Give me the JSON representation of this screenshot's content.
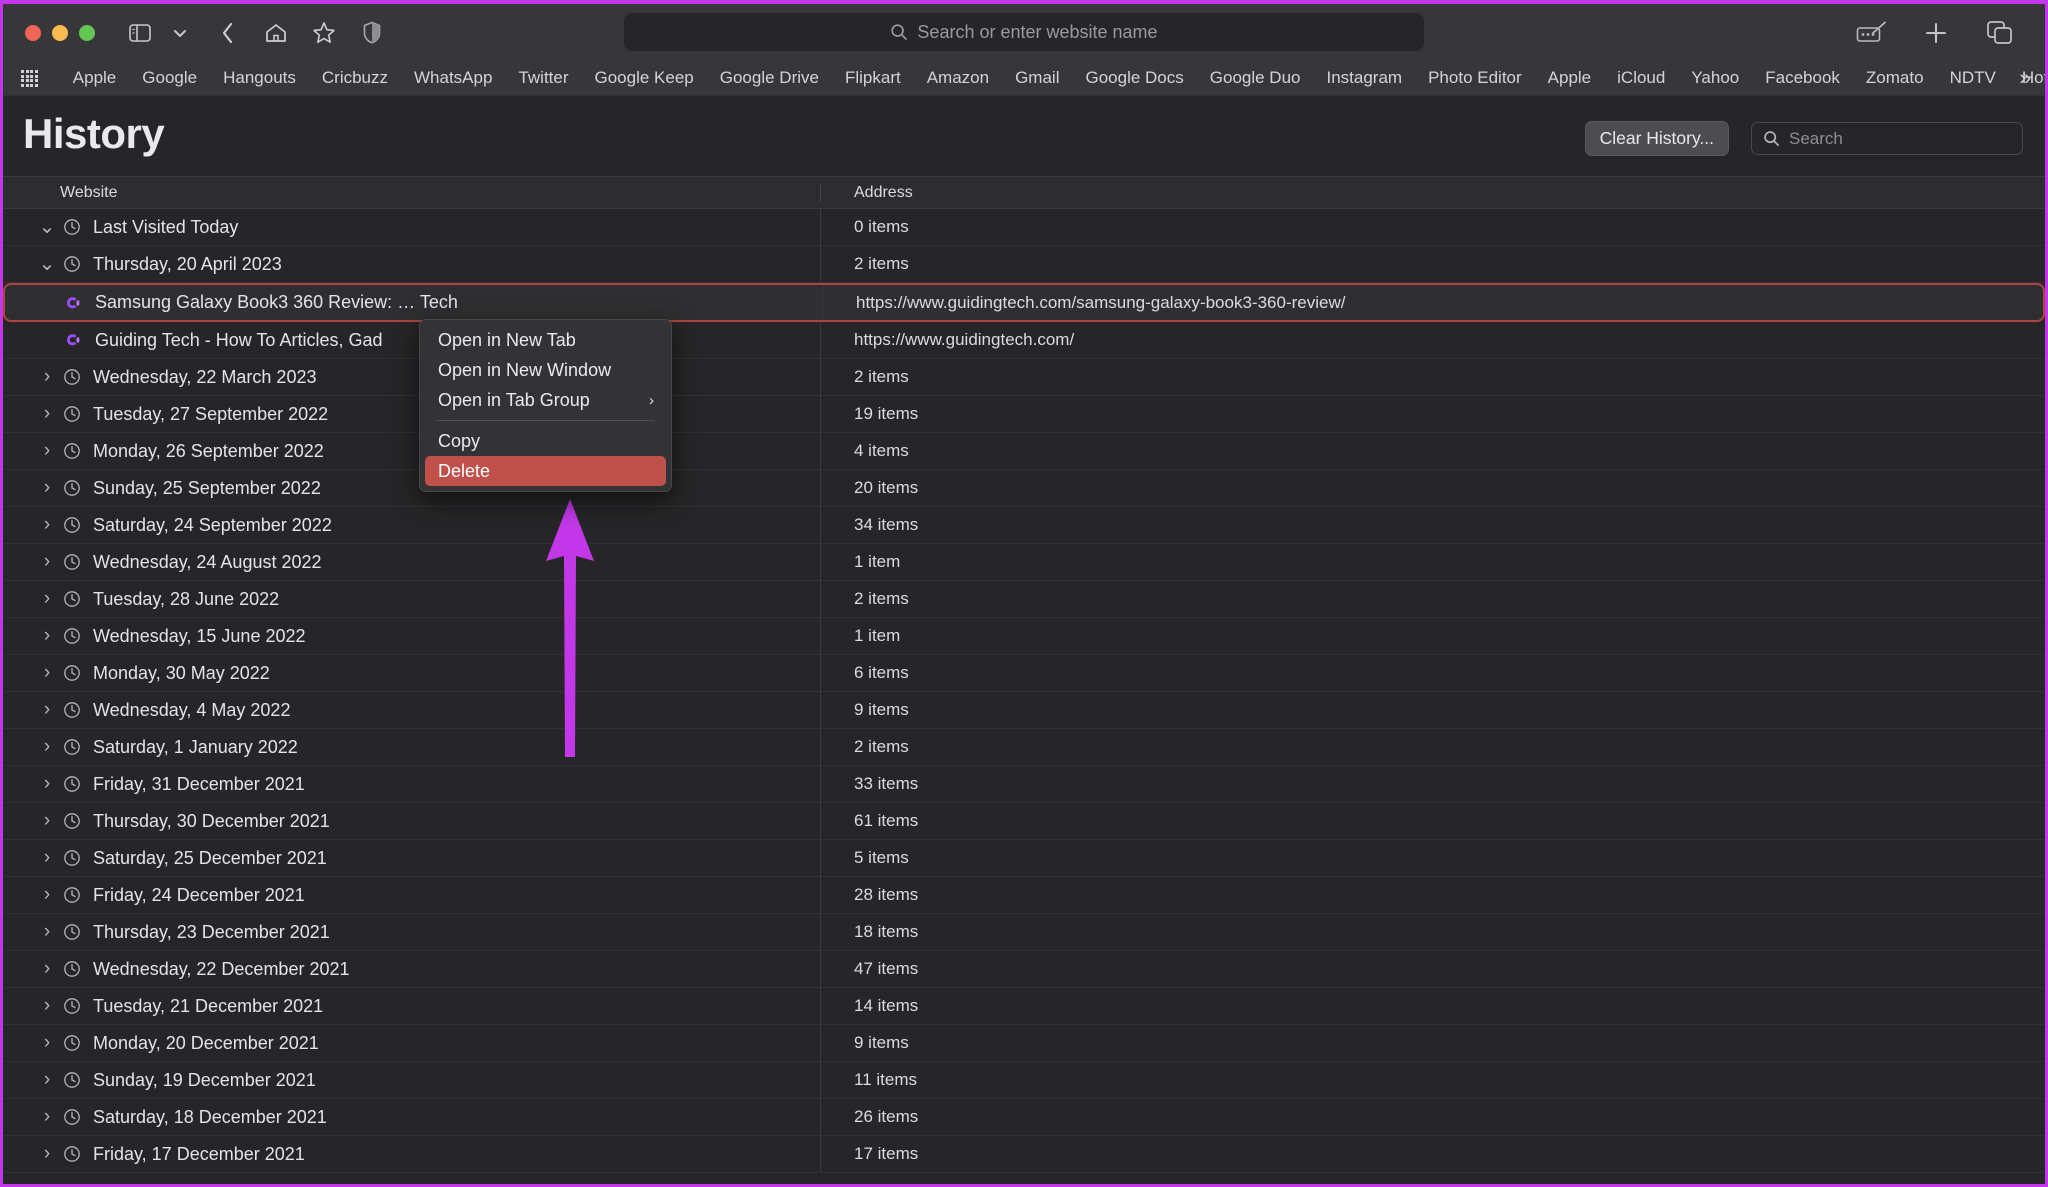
{
  "browser": {
    "traffic_lights": [
      "close",
      "minimize",
      "zoom"
    ],
    "toolbar_icons": [
      "sidebar-icon",
      "chevron-down-icon",
      "back-icon",
      "home-icon",
      "star-icon",
      "shield-icon"
    ],
    "toolbar_right_icons": [
      "compose-icon",
      "new-tab-icon",
      "tab-overview-icon"
    ],
    "url_placeholder": "Search or enter website name"
  },
  "bookmarks": {
    "apps_icon": "apps-grid-icon",
    "items": [
      "Apple",
      "Google",
      "Hangouts",
      "Cricbuzz",
      "WhatsApp",
      "Twitter",
      "Google Keep",
      "Google Drive",
      "Flipkart",
      "Amazon",
      "Gmail",
      "Google Docs",
      "Google Duo",
      "Instagram",
      "Photo Editor",
      "Apple",
      "iCloud",
      "Yahoo",
      "Facebook",
      "Zomato",
      "NDTV",
      "Hotstar"
    ],
    "overflow_label": "»"
  },
  "header": {
    "title": "History",
    "clear_button": "Clear History...",
    "search_placeholder": "Search",
    "search_value": ""
  },
  "table": {
    "columns": [
      "Website",
      "Address"
    ],
    "rows": [
      {
        "type": "group",
        "expanded": true,
        "label": "Last Visited Today",
        "address": "0 items"
      },
      {
        "type": "group",
        "expanded": true,
        "label": "Thursday, 20 April 2023",
        "address": "2 items"
      },
      {
        "type": "item",
        "selected": true,
        "label": "Samsung Galaxy Book3 360 Review: … Tech",
        "address": "https://www.guidingtech.com/samsung-galaxy-book3-360-review/",
        "favicon": "guiding-tech-favicon"
      },
      {
        "type": "item",
        "selected": false,
        "label": "Guiding Tech - How To Articles, Gad",
        "address": "https://www.guidingtech.com/",
        "favicon": "guiding-tech-favicon"
      },
      {
        "type": "group",
        "expanded": false,
        "label": "Wednesday, 22 March 2023",
        "address": "2 items"
      },
      {
        "type": "group",
        "expanded": false,
        "label": "Tuesday, 27 September 2022",
        "address": "19 items"
      },
      {
        "type": "group",
        "expanded": false,
        "label": "Monday, 26 September 2022",
        "address": "4 items"
      },
      {
        "type": "group",
        "expanded": false,
        "label": "Sunday, 25 September 2022",
        "address": "20 items"
      },
      {
        "type": "group",
        "expanded": false,
        "label": "Saturday, 24 September 2022",
        "address": "34 items"
      },
      {
        "type": "group",
        "expanded": false,
        "label": "Wednesday, 24 August 2022",
        "address": "1 item"
      },
      {
        "type": "group",
        "expanded": false,
        "label": "Tuesday, 28 June 2022",
        "address": "2 items"
      },
      {
        "type": "group",
        "expanded": false,
        "label": "Wednesday, 15 June 2022",
        "address": "1 item"
      },
      {
        "type": "group",
        "expanded": false,
        "label": "Monday, 30 May 2022",
        "address": "6 items"
      },
      {
        "type": "group",
        "expanded": false,
        "label": "Wednesday, 4 May 2022",
        "address": "9 items"
      },
      {
        "type": "group",
        "expanded": false,
        "label": "Saturday, 1 January 2022",
        "address": "2 items"
      },
      {
        "type": "group",
        "expanded": false,
        "label": "Friday, 31 December 2021",
        "address": "33 items"
      },
      {
        "type": "group",
        "expanded": false,
        "label": "Thursday, 30 December 2021",
        "address": "61 items"
      },
      {
        "type": "group",
        "expanded": false,
        "label": "Saturday, 25 December 2021",
        "address": "5 items"
      },
      {
        "type": "group",
        "expanded": false,
        "label": "Friday, 24 December 2021",
        "address": "28 items"
      },
      {
        "type": "group",
        "expanded": false,
        "label": "Thursday, 23 December 2021",
        "address": "18 items"
      },
      {
        "type": "group",
        "expanded": false,
        "label": "Wednesday, 22 December 2021",
        "address": "47 items"
      },
      {
        "type": "group",
        "expanded": false,
        "label": "Tuesday, 21 December 2021",
        "address": "14 items"
      },
      {
        "type": "group",
        "expanded": false,
        "label": "Monday, 20 December 2021",
        "address": "9 items"
      },
      {
        "type": "group",
        "expanded": false,
        "label": "Sunday, 19 December 2021",
        "address": "11 items"
      },
      {
        "type": "group",
        "expanded": false,
        "label": "Saturday, 18 December 2021",
        "address": "26 items"
      },
      {
        "type": "group",
        "expanded": false,
        "label": "Friday, 17 December 2021",
        "address": "17 items"
      }
    ]
  },
  "context_menu": {
    "items": [
      {
        "label": "Open in New Tab",
        "submenu": false,
        "highlighted": false,
        "separator_after": false
      },
      {
        "label": "Open in New Window",
        "submenu": false,
        "highlighted": false,
        "separator_after": false
      },
      {
        "label": "Open in Tab Group",
        "submenu": true,
        "highlighted": false,
        "separator_after": true
      },
      {
        "label": "Copy",
        "submenu": false,
        "highlighted": false,
        "separator_after": false
      },
      {
        "label": "Delete",
        "submenu": false,
        "highlighted": true,
        "separator_after": false
      }
    ],
    "submenu_glyph": "›"
  },
  "annotation": {
    "arrow_color": "#c238e8",
    "arrow_points_to": "Delete"
  },
  "colors": {
    "accent_border": "#c238e8",
    "selection_border": "#b0453f",
    "danger": "#c0504a",
    "toolbar_bg": "#37373a",
    "page_bg": "#262628",
    "favicon_purple": "#a855f7"
  }
}
